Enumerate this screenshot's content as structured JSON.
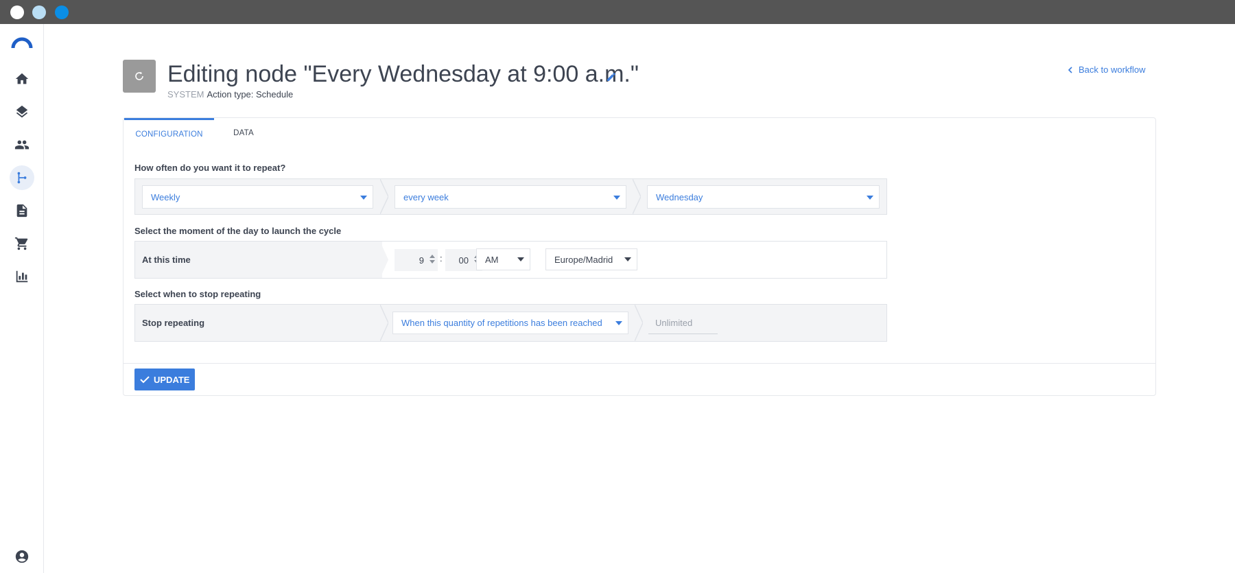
{
  "window": {
    "controls": [
      "close",
      "minimize",
      "maximize"
    ]
  },
  "sidebar": {
    "items": [
      {
        "name": "home",
        "icon": "home-icon"
      },
      {
        "name": "layers",
        "icon": "layers-icon"
      },
      {
        "name": "users",
        "icon": "people-icon"
      },
      {
        "name": "workflows",
        "icon": "workflow-icon",
        "active": true
      },
      {
        "name": "documents",
        "icon": "document-icon"
      },
      {
        "name": "cart",
        "icon": "cart-icon"
      },
      {
        "name": "reports",
        "icon": "bar-chart-icon"
      },
      {
        "name": "account",
        "icon": "account-icon"
      }
    ]
  },
  "header": {
    "title": "Editing node \"Every Wednesday at 9:00 a.m.\"",
    "system_label": "SYSTEM",
    "action_type": "Action type: Schedule",
    "back_link": "Back to workflow"
  },
  "tabs": [
    {
      "label": "CONFIGURATION",
      "active": true
    },
    {
      "label": "DATA",
      "active": false
    }
  ],
  "repeat": {
    "question": "How often do you want it to repeat?",
    "frequency": "Weekly",
    "interval": "every week",
    "day": "Wednesday"
  },
  "time": {
    "question": "Select the moment of the day to launch the cycle",
    "label": "At this time",
    "hour": "9",
    "separator": ":",
    "minute": "00",
    "meridiem": "AM",
    "timezone": "Europe/Madrid"
  },
  "stop": {
    "question": "Select when to stop repeating",
    "label": "Stop repeating",
    "condition": "When this quantity of repetitions has been reached",
    "limit_placeholder": "Unlimited"
  },
  "actions": {
    "update_label": "UPDATE"
  },
  "colors": {
    "accent": "#3b7ddd",
    "text": "#3d4451",
    "muted": "#9aa0aa",
    "titlebar": "#555555"
  }
}
